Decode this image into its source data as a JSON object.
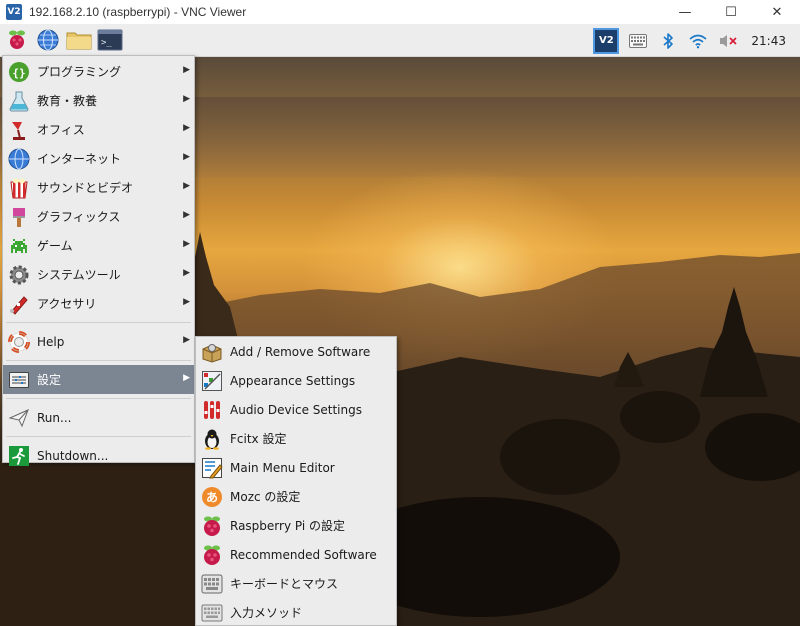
{
  "window": {
    "logo_text": "V2",
    "title": "192.168.2.10 (raspberrypi) - VNC Viewer",
    "minimize_glyph": "—",
    "maximize_glyph": "☐",
    "close_glyph": "✕"
  },
  "panel": {
    "launchers": [
      "raspberry-menu-icon",
      "web-browser-icon",
      "file-manager-icon",
      "terminal-icon"
    ],
    "tray": {
      "vnc_label": "V2",
      "icons": [
        "vnc-server-icon",
        "keyboard-icon",
        "bluetooth-icon",
        "wifi-icon",
        "volume-muted-icon"
      ],
      "clock": "21:43"
    }
  },
  "main_menu": {
    "items": [
      {
        "label": "プログラミング",
        "icon": "programming-icon",
        "submenu": true
      },
      {
        "label": "教育・教養",
        "icon": "education-icon",
        "submenu": true
      },
      {
        "label": "オフィス",
        "icon": "office-icon",
        "submenu": true
      },
      {
        "label": "インターネット",
        "icon": "internet-icon",
        "submenu": true
      },
      {
        "label": "サウンドとビデオ",
        "icon": "sound-video-icon",
        "submenu": true
      },
      {
        "label": "グラフィックス",
        "icon": "graphics-icon",
        "submenu": true
      },
      {
        "label": "ゲーム",
        "icon": "games-icon",
        "submenu": true
      },
      {
        "label": "システムツール",
        "icon": "system-tools-icon",
        "submenu": true
      },
      {
        "label": "アクセサリ",
        "icon": "accessories-icon",
        "submenu": true
      },
      {
        "label": "Help",
        "icon": "help-icon",
        "submenu": true
      },
      {
        "label": "設定",
        "icon": "preferences-icon",
        "submenu": true,
        "active": true
      },
      {
        "label": "Run...",
        "icon": "run-icon",
        "submenu": false
      },
      {
        "label": "Shutdown...",
        "icon": "shutdown-icon",
        "submenu": false
      }
    ],
    "arrow": "▶"
  },
  "sub_menu": {
    "items": [
      {
        "label": "Add / Remove Software",
        "icon": "add-remove-software-icon"
      },
      {
        "label": "Appearance Settings",
        "icon": "appearance-settings-icon"
      },
      {
        "label": "Audio Device Settings",
        "icon": "audio-device-settings-icon"
      },
      {
        "label": "Fcitx 設定",
        "icon": "fcitx-penguin-icon"
      },
      {
        "label": "Main Menu Editor",
        "icon": "main-menu-editor-icon"
      },
      {
        "label": "Mozc の設定",
        "icon": "mozc-icon"
      },
      {
        "label": "Raspberry Pi の設定",
        "icon": "raspberry-pi-config-icon"
      },
      {
        "label": "Recommended Software",
        "icon": "recommended-software-icon"
      },
      {
        "label": "キーボードとマウス",
        "icon": "keyboard-mouse-icon"
      },
      {
        "label": "入力メソッド",
        "icon": "input-method-icon"
      }
    ]
  },
  "colors": {
    "menu_bg": "#ececec",
    "menu_highlight": "#7c8592",
    "panel_bg": "#ededed",
    "raspberry_red": "#c51a4a",
    "vnc_blue": "#1b3f6a"
  }
}
